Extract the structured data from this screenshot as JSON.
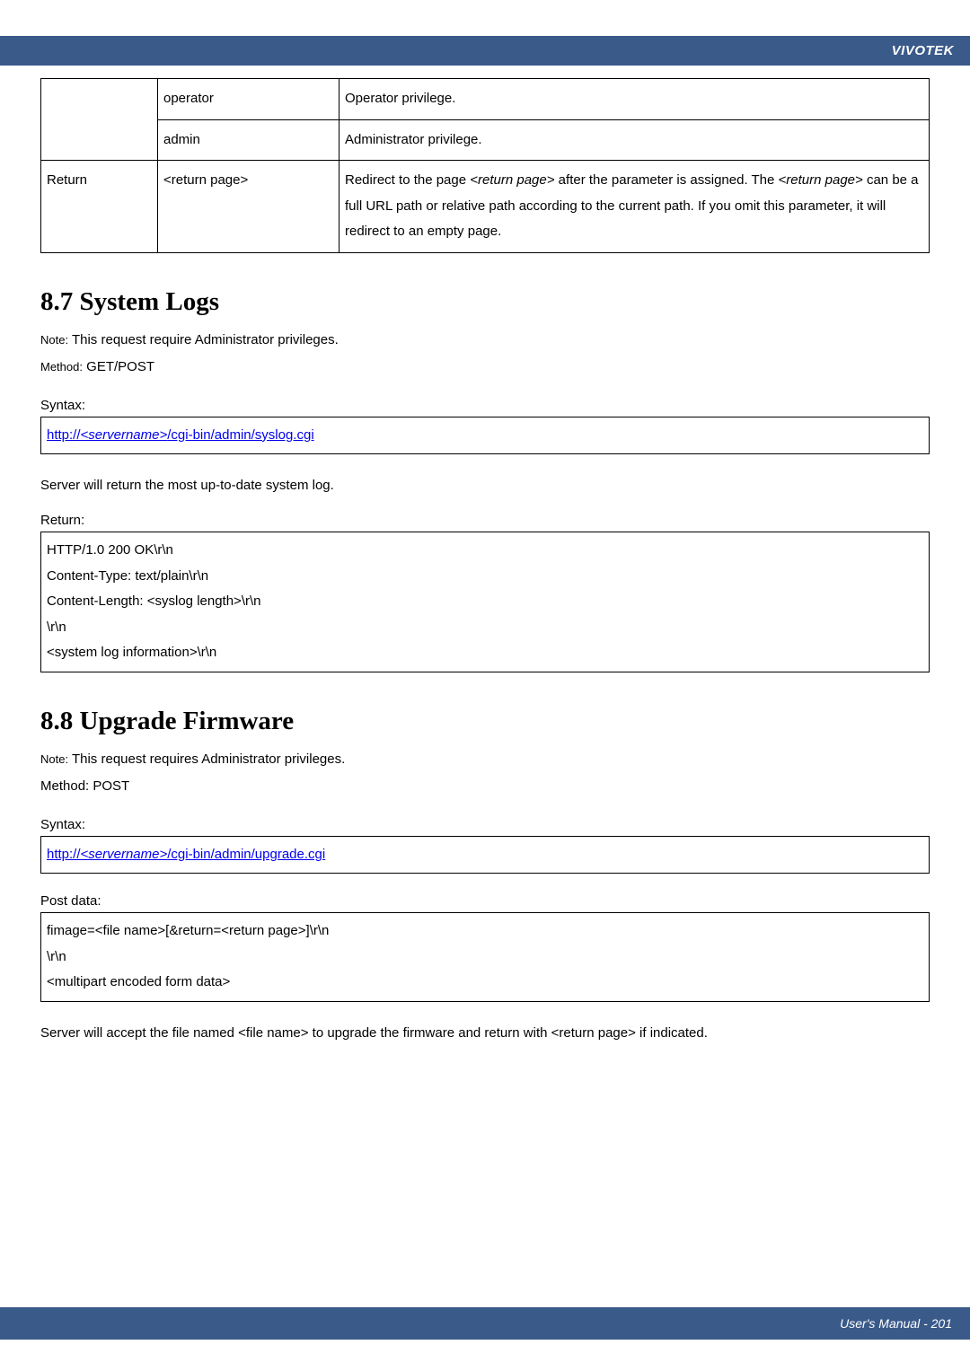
{
  "header": {
    "brand": "VIVOTEK"
  },
  "paramsTable": {
    "rows": [
      {
        "c1": "",
        "c2": "operator",
        "c3": "Operator privilege."
      },
      {
        "c1": "",
        "c2": "admin",
        "c3": "Administrator privilege."
      },
      {
        "c1": "Return",
        "c2": "<return page>",
        "c3_prefix": "Redirect to the page ",
        "c3_ital1": "<return page>",
        "c3_mid1": " after the parameter is assigned. The ",
        "c3_ital2": "<return page>",
        "c3_mid2": " can be a full URL path or relative path according to the current path. If you omit this parameter, it will redirect to an empty page."
      }
    ]
  },
  "section87": {
    "heading": "8.7 System Logs",
    "noteLabel": "Note:",
    "noteText": " This request require Administrator privileges.",
    "methodLabel": "Method:",
    "methodText": " GET/POST",
    "syntaxLabel": "Syntax:",
    "link_prefix": "http://",
    "link_ital": "<servername>",
    "link_suffix": "/cgi-bin/admin/syslog.cgi",
    "desc": "Server will return the most up-to-date system log.",
    "returnLabel": "Return:",
    "returnBox": "HTTP/1.0 200 OK\\r\\n\nContent-Type: text/plain\\r\\n\nContent-Length: <syslog length>\\r\\n\n\\r\\n\n<system log information>\\r\\n"
  },
  "section88": {
    "heading": "8.8 Upgrade Firmware",
    "noteLabel": "Note:",
    "noteText": " This request requires Administrator privileges.",
    "methodLine": "Method: POST",
    "syntaxLabel": "Syntax:",
    "link_prefix": "http://",
    "link_ital": "<servername>",
    "link_suffix": "/cgi-bin/admin/upgrade.cgi",
    "postLabel": "Post data:",
    "postBox": "fimage=<file name>[&return=<return page>]\\r\\n\n\\r\\n\n<multipart encoded form data>",
    "desc": "Server will accept the file named <file name> to upgrade the firmware and return with <return page> if indicated."
  },
  "footer": {
    "text": "User's Manual - 201"
  }
}
